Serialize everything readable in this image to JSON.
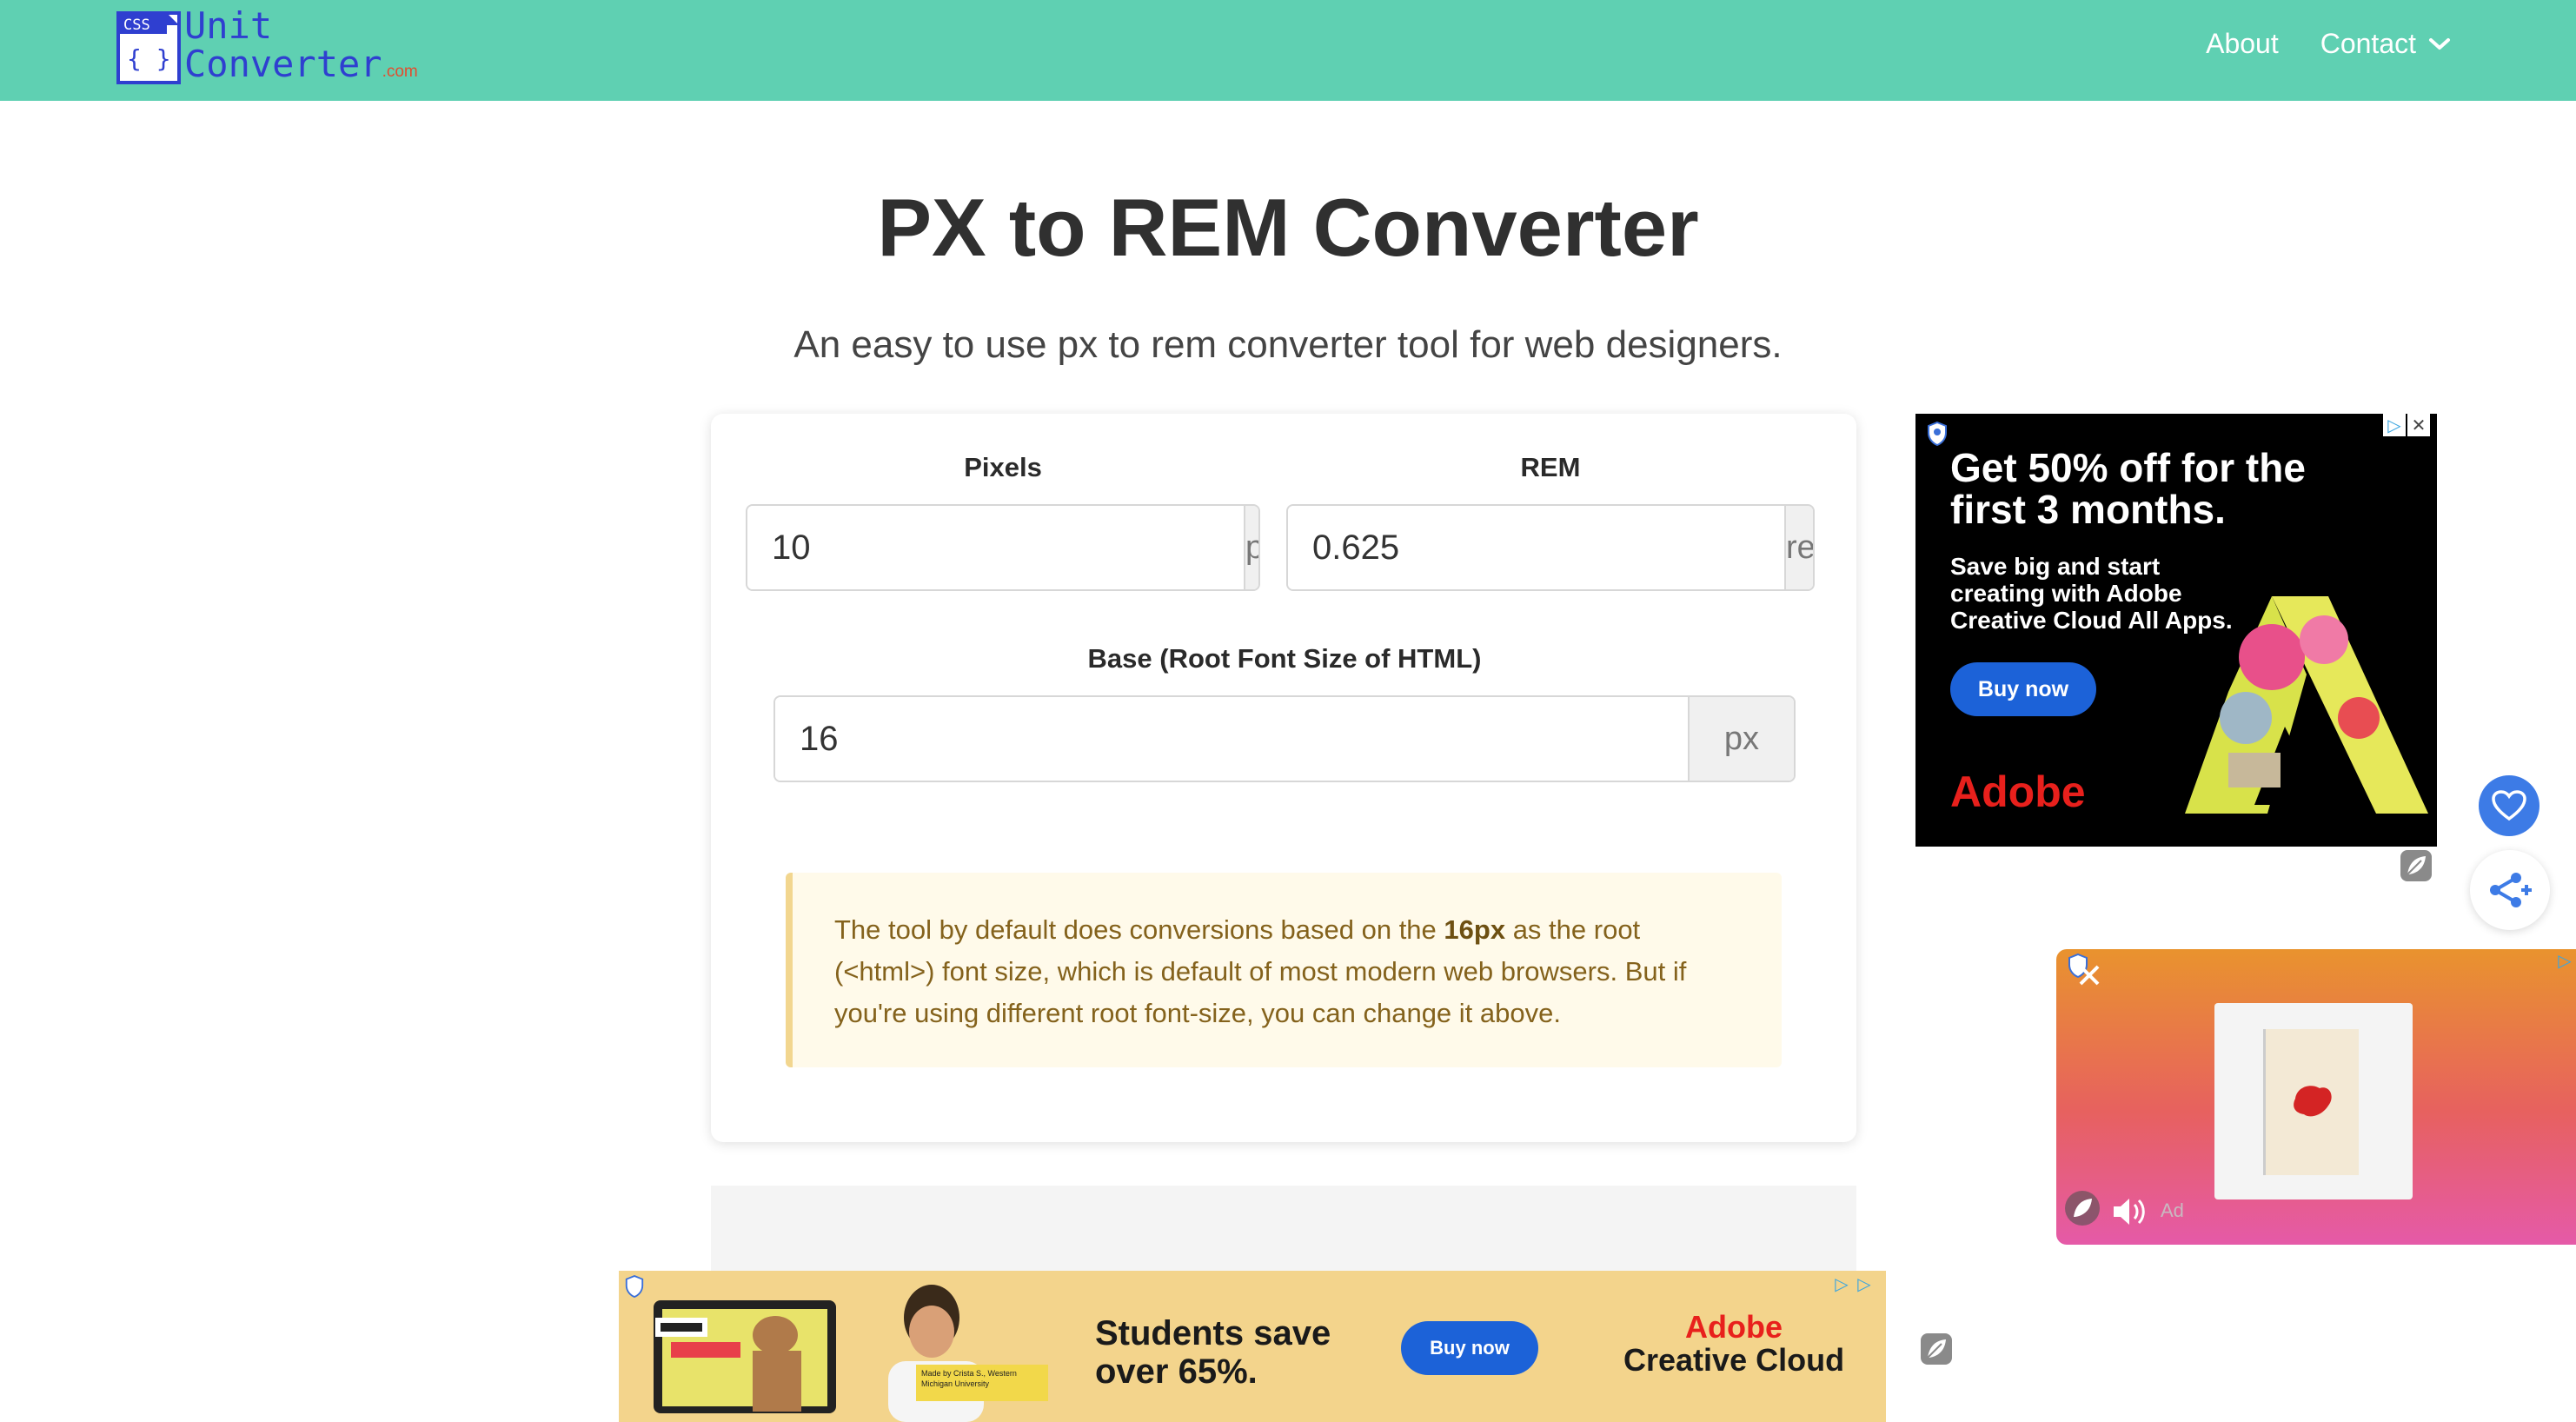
{
  "header": {
    "logo_badge": "CSS",
    "logo_braces": "{ }",
    "logo_line1": "Unit",
    "logo_line2": "Converter",
    "logo_suffix": ".com",
    "nav_about": "About",
    "nav_contact": "Contact"
  },
  "page": {
    "title": "PX to REM Converter",
    "subtitle": "An easy to use px to rem converter tool for web designers."
  },
  "converter": {
    "pixels_label": "Pixels",
    "pixels_value": "10",
    "pixels_unit": "px",
    "rem_label": "REM",
    "rem_value": "0.625",
    "rem_unit": "rem",
    "base_label": "Base (Root Font Size of HTML)",
    "base_value": "16",
    "base_unit": "px"
  },
  "note": {
    "before": "The tool by default does conversions based on the ",
    "bold": "16px",
    "after": " as the root (<html>) font size, which is default of most modern web browsers. But if you're using different root font-size, you can change it above."
  },
  "ad_right": {
    "headline": "Get 50% off for the first 3 months.",
    "body": "Save big and start creating with Adobe Creative Cloud All Apps.",
    "button": "Buy now",
    "brand": "Adobe"
  },
  "ad_video": {
    "label": "Ad"
  },
  "ad_bottom": {
    "caption": "Made by Crista S., Western Michigan University",
    "headline": "Students save over 65%.",
    "button": "Buy now",
    "brand_line1": "Adobe",
    "brand_line2": "Creative Cloud"
  },
  "icons": [
    "chevron-down-icon",
    "heart-icon",
    "share-icon",
    "close-icon",
    "speaker-icon",
    "leaf-icon",
    "adchoices-icon",
    "shield-icon"
  ],
  "colors": {
    "header_bg": "#5fd0b2",
    "logo_blue": "#2f3fd0",
    "note_bg": "#fffaea",
    "note_border": "#f2d68f",
    "note_text": "#84621c",
    "adobe_red": "#e8201c",
    "button_blue": "#1c62d8",
    "fab_blue": "#3d7be6"
  }
}
